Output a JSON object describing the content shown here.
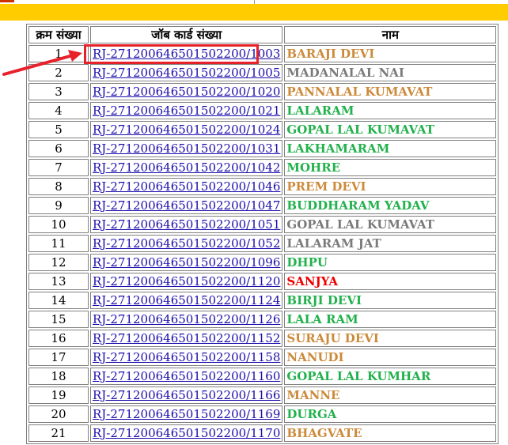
{
  "header": {
    "col_sn": "क्रम संख्या",
    "col_jobcard": "जॉब कार्ड संख्या",
    "col_name": "नाम"
  },
  "colors": {
    "orange": "#cc8a3a",
    "gray": "#7a7a7a",
    "green": "#22b14c",
    "red": "#ee0000",
    "link": "#1a0dab",
    "banner": "#ffcc00",
    "annotation": "#e8202a"
  },
  "rows": [
    {
      "sn": "1",
      "jobcard": "RJ-2712006465015022​00/1003",
      "name": "BARAJI DEVI",
      "color": "orange"
    },
    {
      "sn": "2",
      "jobcard": "RJ-271200646501502200/1005",
      "name": "MADANALAL NAI",
      "color": "gray"
    },
    {
      "sn": "3",
      "jobcard": "RJ-271200646501502200/1020",
      "name": "PANNALAL KUMAVAT",
      "color": "orange"
    },
    {
      "sn": "4",
      "jobcard": "RJ-271200646501502200/1021",
      "name": "LALARAM",
      "color": "green"
    },
    {
      "sn": "5",
      "jobcard": "RJ-271200646501502200/1024",
      "name": "GOPAL LAL KUMAVAT",
      "color": "green"
    },
    {
      "sn": "6",
      "jobcard": "RJ-271200646501502200/1031",
      "name": "LAKHAMARAM",
      "color": "green"
    },
    {
      "sn": "7",
      "jobcard": "RJ-271200646501502200/1042",
      "name": "MOHRE",
      "color": "green"
    },
    {
      "sn": "8",
      "jobcard": "RJ-271200646501502200/1046",
      "name": "PREM DEVI",
      "color": "orange"
    },
    {
      "sn": "9",
      "jobcard": "RJ-271200646501502200/1047",
      "name": "BUDDHARAM YADAV",
      "color": "green"
    },
    {
      "sn": "10",
      "jobcard": "RJ-271200646501502200/1051",
      "name": "GOPAL LAL KUMAVAT",
      "color": "gray"
    },
    {
      "sn": "11",
      "jobcard": "RJ-271200646501502200/1052",
      "name": "LALARAM JAT",
      "color": "gray"
    },
    {
      "sn": "12",
      "jobcard": "RJ-271200646501502200/1096",
      "name": "DHPU",
      "color": "green"
    },
    {
      "sn": "13",
      "jobcard": "RJ-271200646501502200/1120",
      "name": "SANJYA",
      "color": "red"
    },
    {
      "sn": "14",
      "jobcard": "RJ-271200646501502200/1124",
      "name": "BIRJI DEVI",
      "color": "green"
    },
    {
      "sn": "15",
      "jobcard": "RJ-271200646501502200/1126",
      "name": "LALA RAM",
      "color": "green"
    },
    {
      "sn": "16",
      "jobcard": "RJ-271200646501502200/1152",
      "name": "SURAJU DEVI",
      "color": "orange"
    },
    {
      "sn": "17",
      "jobcard": "RJ-271200646501502200/1158",
      "name": "NANUDI",
      "color": "orange"
    },
    {
      "sn": "18",
      "jobcard": "RJ-271200646501502200/1160",
      "name": "GOPAL LAL KUMHAR",
      "color": "green"
    },
    {
      "sn": "19",
      "jobcard": "RJ-271200646501502200/1166",
      "name": "MANNE",
      "color": "orange"
    },
    {
      "sn": "20",
      "jobcard": "RJ-271200646501502200/1169",
      "name": "DURGA",
      "color": "green"
    },
    {
      "sn": "21",
      "jobcard": "RJ-271200646501502200/1170",
      "name": "BHAGVATE",
      "color": "orange"
    }
  ]
}
